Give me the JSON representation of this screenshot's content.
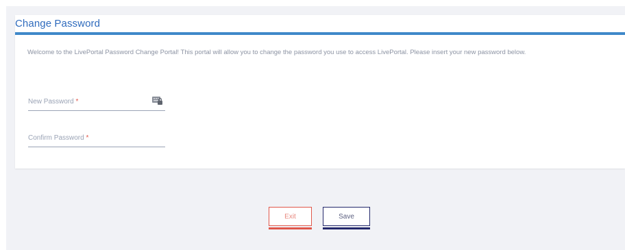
{
  "card": {
    "title": "Change Password",
    "intro": "Welcome to the LivePortal Password Change Portal! This portal will allow you to change the password you use to access LivePortal. Please insert your new password below."
  },
  "fields": {
    "new_password": {
      "label": "New Password",
      "required_mark": "*",
      "value": ""
    },
    "confirm_password": {
      "label": "Confirm Password",
      "required_mark": "*",
      "value": ""
    }
  },
  "icons": {
    "password_field": "keyboard-lock-icon"
  },
  "buttons": {
    "exit_label": "Exit",
    "save_label": "Save"
  },
  "colors": {
    "accent": "#3f88c9",
    "title": "#2f6bbd",
    "exit": "#e0564a",
    "save": "#23286b",
    "required": "#e0564a"
  }
}
